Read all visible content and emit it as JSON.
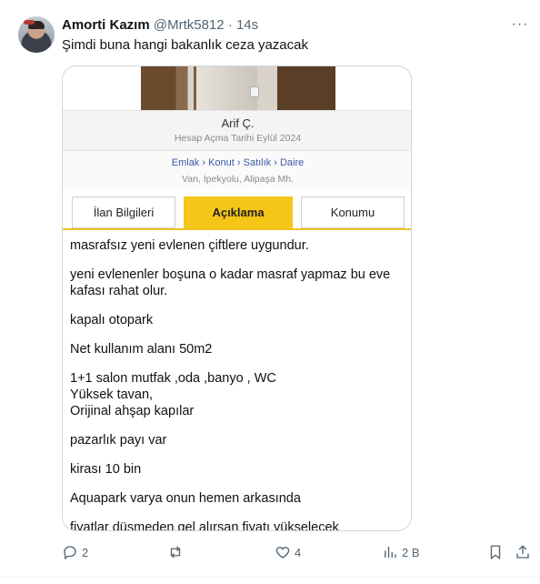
{
  "tweet": {
    "author_name": "Amorti Kazım",
    "handle": "@Mrtk5812",
    "separator": "·",
    "time": "14s",
    "more_glyph": "···",
    "text": "Şimdi buna hangi bakanlık ceza yazacak"
  },
  "listing": {
    "seller_name": "Arif Ç.",
    "account_date": "Hesap Açma Tarihi  Eylül 2024",
    "breadcrumb": "Emlak › Konut › Satılık › Daire",
    "location": "Van, İpekyolu, Alipaşa Mh.",
    "tabs": [
      {
        "label": "İlan Bilgileri",
        "active": false
      },
      {
        "label": "Açıklama",
        "active": true
      },
      {
        "label": "Konumu",
        "active": false
      }
    ],
    "description": [
      "masrafsız yeni evlenen çiftlere uygundur.",
      "yeni evlenenler boşuna o kadar masraf yapmaz bu eve kafası rahat olur.",
      "kapalı otopark",
      "Net kullanım alanı 50m2",
      "1+1 salon mutfak ,oda ,banyo , WC",
      "Yüksek tavan,",
      "Orijinal ahşap kapılar",
      "pazarlık payı var",
      "kirası 10 bin",
      "Aquapark varya onun hemen arkasında",
      "fiyatlar düşmeden gel alırsan fiyatı yükselecek"
    ],
    "accent_color": "#f5c518",
    "link_color": "#3a5aa8"
  },
  "actions": {
    "reply_count": "2",
    "repost_count": "",
    "like_count": "4",
    "views_count": "2 B"
  },
  "colors": {
    "text": "#0f1419",
    "secondary": "#536471",
    "border": "#cfd9de"
  }
}
